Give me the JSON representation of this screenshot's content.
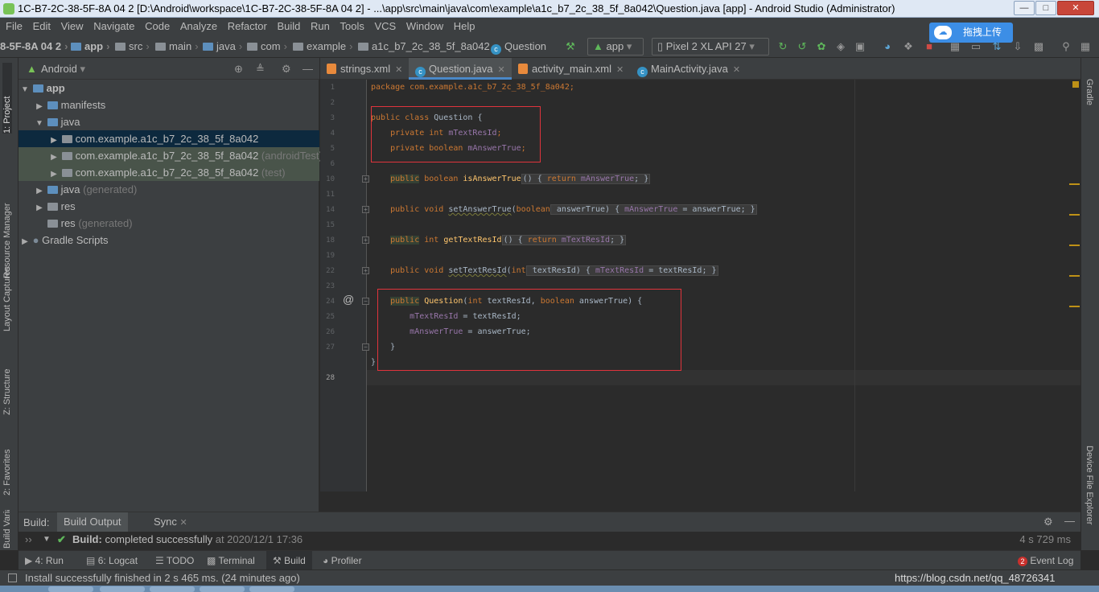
{
  "window": {
    "title": "1C-B7-2C-38-5F-8A 04 2 [D:\\Android\\workspace\\1C-B7-2C-38-5F-8A 04 2] - ...\\app\\src\\main\\java\\com\\example\\a1c_b7_2c_38_5f_8a042\\Question.java [app] - Android Studio (Administrator)"
  },
  "menu": [
    "File",
    "Edit",
    "View",
    "Navigate",
    "Code",
    "Analyze",
    "Refactor",
    "Build",
    "Run",
    "Tools",
    "VCS",
    "Window",
    "Help"
  ],
  "breadcrumbs": [
    "8-5F-8A 04 2",
    "app",
    "src",
    "main",
    "java",
    "com",
    "example",
    "a1c_b7_2c_38_5f_8a042",
    "Question"
  ],
  "toolbar": {
    "run_config": "app",
    "device": "Pixel 2 XL API 27",
    "upload_label": "拖拽上传"
  },
  "project_panel": {
    "view": "Android"
  },
  "tree": [
    {
      "label": "app",
      "suffix": ""
    },
    {
      "label": "manifests",
      "suffix": ""
    },
    {
      "label": "java",
      "suffix": ""
    },
    {
      "label": "com.example.a1c_b7_2c_38_5f_8a042",
      "suffix": ""
    },
    {
      "label": "com.example.a1c_b7_2c_38_5f_8a042",
      "suffix": "(androidTest)"
    },
    {
      "label": "com.example.a1c_b7_2c_38_5f_8a042",
      "suffix": "(test)"
    },
    {
      "label": "java",
      "suffix": "(generated)"
    },
    {
      "label": "res",
      "suffix": ""
    },
    {
      "label": "res",
      "suffix": "(generated)"
    },
    {
      "label": "Gradle Scripts",
      "suffix": ""
    }
  ],
  "tabs": [
    "strings.xml",
    "Question.java",
    "activity_main.xml",
    "MainActivity.java"
  ],
  "gutter_lines": [
    "1",
    "2",
    "3",
    "4",
    "5",
    "6",
    "10",
    "11",
    "14",
    "15",
    "18",
    "19",
    "22",
    "23",
    "24",
    "25",
    "26",
    "27",
    "28"
  ],
  "code": {
    "l1": "package com.example.a1c_b7_2c_38_5f_8a042;",
    "l3_kw": "public class",
    "l3_rest": " Question {",
    "l4_kw": "    private int ",
    "l4_f": "mTextResId",
    "l5_kw": "    private boolean ",
    "l5_f": "mAnswerTrue",
    "l6_pub": "public",
    "l6_kw": " boolean ",
    "l6_m": "isAnswerTrue",
    "l6_b": "() { ",
    "l6_ret": "return ",
    "l6_f": "mAnswerTrue",
    "l6_e": "; }",
    "l10_kw": "public void ",
    "l10_m": "setAnswerTrue",
    "l10_a": "(",
    "l10_bool": "boolean",
    "l10_b": " answerTrue) { ",
    "l10_f": "mAnswerTrue",
    "l10_e": " = answerTrue; }",
    "l14_pub": "public",
    "l14_kw": " int ",
    "l14_m": "getTextResId",
    "l14_b": "() { ",
    "l14_ret": "return ",
    "l14_f": "mTextResId",
    "l14_e": "; }",
    "l18_kw": "public void ",
    "l18_m": "setTextResId",
    "l18_a": "(",
    "l18_int": "int",
    "l18_b": " textResId) { ",
    "l18_f": "mTextResId",
    "l18_e": " = textResId; }",
    "l22_pub": "public",
    "l22_m": " Question",
    "l22_a": "(",
    "l22_int": "int",
    "l22_b": " textResId, ",
    "l22_bool": "boolean",
    "l22_c": " answerTrue) {",
    "l23_f": "mTextResId",
    "l23_e": " = textResId;",
    "l24_f": "mAnswerTrue",
    "l24_e": " = answerTrue;",
    "l25": "    }",
    "l26": "}"
  },
  "build": {
    "label": "Build:",
    "tab_output": "Build Output",
    "tab_sync": "Sync",
    "status_bold": "Build:",
    "status_text": " completed successfully",
    "status_time": " at 2020/12/1 17:36",
    "duration": "4 s 729 ms"
  },
  "tool_windows": [
    "4: Run",
    "6: Logcat",
    "TODO",
    "Terminal",
    "Build",
    "Profiler"
  ],
  "event_log": {
    "count": "2",
    "label": "Event Log"
  },
  "statusbar": {
    "message": "Install successfully finished in 2 s 465 ms. (24 minutes ago)",
    "watermark": "https://blog.csdn.net/qq_48726341"
  },
  "side_tabs": {
    "left": [
      "1: Project",
      "Resource Manager",
      "Layout Captures",
      "Z: Structure",
      "2: Favorites",
      "Build Variants"
    ],
    "right": [
      "Gradle",
      "Device File Explorer"
    ]
  },
  "colors": {
    "bg": "#2b2b2b",
    "panel": "#3c3f41",
    "keyword": "#cc7832",
    "field": "#9876aa",
    "method": "#ffc66d",
    "highlight_box": "#e0343c",
    "success": "#5fb85b",
    "selection": "#0d293e"
  }
}
